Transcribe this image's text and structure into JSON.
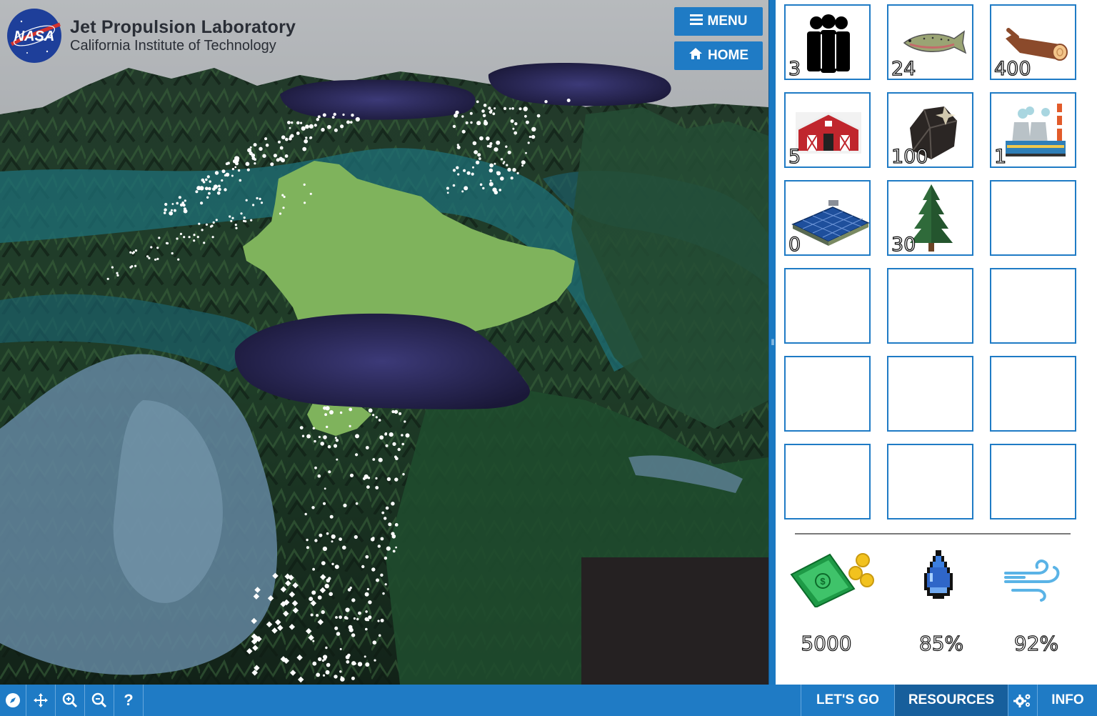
{
  "header": {
    "logo_text": "NASA",
    "lab_title": "Jet Propulsion Laboratory",
    "lab_subtitle": "California Institute of Technology",
    "menu_label": "MENU",
    "home_label": "HOME"
  },
  "resources": [
    {
      "name": "people",
      "icon": "people-icon",
      "count": "3"
    },
    {
      "name": "fish",
      "icon": "trout-icon",
      "count": "24"
    },
    {
      "name": "lumber",
      "icon": "log-icon",
      "count": "400"
    },
    {
      "name": "farms",
      "icon": "barn-icon",
      "count": "5"
    },
    {
      "name": "coal",
      "icon": "coal-icon",
      "count": "100"
    },
    {
      "name": "power plants",
      "icon": "power-plant-icon",
      "count": "1"
    },
    {
      "name": "solar panels",
      "icon": "solar-panel-icon",
      "count": "0"
    },
    {
      "name": "trees",
      "icon": "pine-tree-icon",
      "count": "30"
    }
  ],
  "stats": {
    "money": "5000",
    "water": "85%",
    "air": "92%"
  },
  "toolbar": {
    "lets_go": "LET'S GO",
    "resources": "RESOURCES",
    "info": "INFO",
    "help_glyph": "?"
  },
  "colors": {
    "accent": "#1f7bc5",
    "active_tab": "#175f9c",
    "highlight_region": "#7fb35c"
  }
}
